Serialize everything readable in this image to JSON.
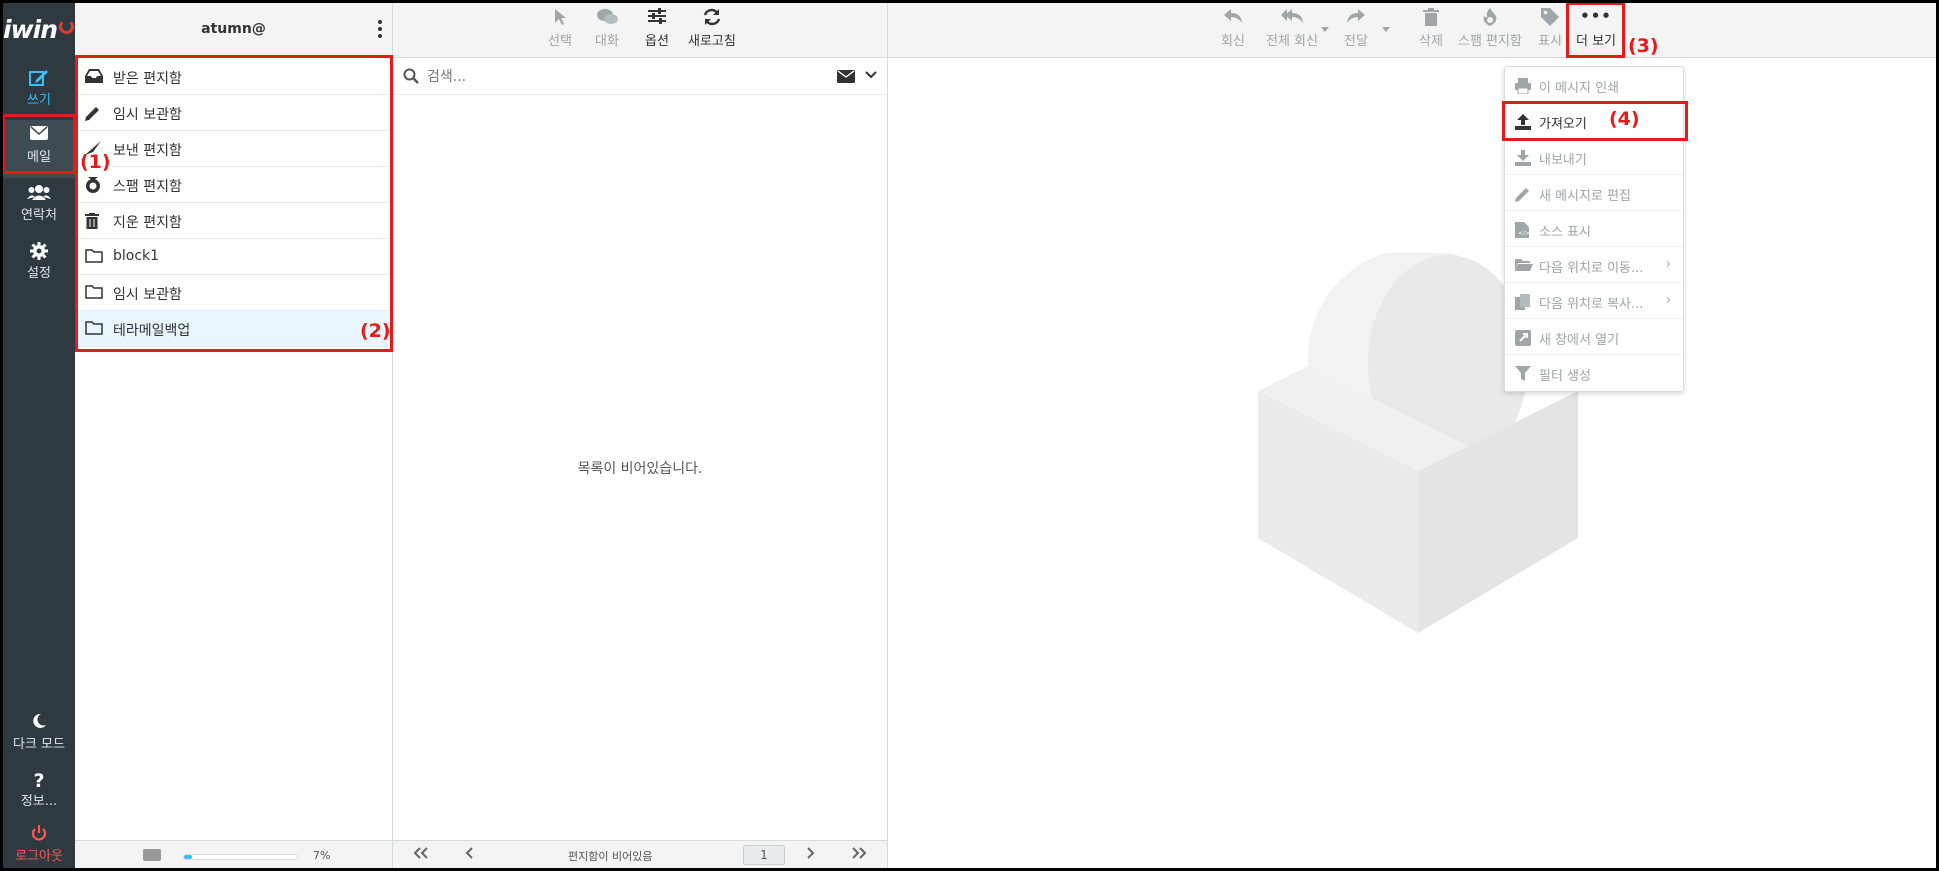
{
  "app": {
    "logo_text": "iwin",
    "user": "atumn@"
  },
  "nav": {
    "compose": "쓰기",
    "mail": "메일",
    "contacts": "연락처",
    "settings": "설정",
    "dark_mode": "다크 모드",
    "info": "정보...",
    "logout": "로그아웃"
  },
  "folders": [
    {
      "label": "받은 편지함",
      "icon": "inbox-icon"
    },
    {
      "label": "임시 보관함",
      "icon": "pencil-icon"
    },
    {
      "label": "보낸 편지함",
      "icon": "paper-plane-icon"
    },
    {
      "label": "스팸 편지함",
      "icon": "spam-icon"
    },
    {
      "label": "지운 편지함",
      "icon": "trash-icon"
    },
    {
      "label": "block1",
      "icon": "folder-icon"
    },
    {
      "label": "임시 보관함",
      "icon": "folder-icon"
    },
    {
      "label": "테라메일백업",
      "icon": "folder-icon",
      "selected": true
    }
  ],
  "quota": {
    "percent_label": "7%",
    "fraction": 0.07
  },
  "list_toolbar": {
    "select": "선택",
    "threads": "대화",
    "options": "옵션",
    "refresh": "새로고침"
  },
  "search": {
    "placeholder": "검색..."
  },
  "list": {
    "empty": "목록이 비어있습니다."
  },
  "pager": {
    "count": "편지함이 비어있음",
    "page": "1"
  },
  "preview_toolbar": {
    "reply": "회신",
    "reply_all": "전체 회신",
    "forward": "전달",
    "delete": "삭제",
    "spam": "스팸 편지함",
    "mark": "표시",
    "more": "더 보기"
  },
  "more_menu": [
    {
      "label": "이 메시지 인쇄",
      "enabled": false
    },
    {
      "label": "가져오기",
      "enabled": true
    },
    {
      "label": "내보내기",
      "enabled": false
    },
    {
      "label": "새 메시지로 편집",
      "enabled": false
    },
    {
      "label": "소스 표시",
      "enabled": false
    },
    {
      "label": "다음 위치로 이동...",
      "enabled": false,
      "submenu": true
    },
    {
      "label": "다음 위치로 복사...",
      "enabled": false,
      "submenu": true
    },
    {
      "label": "새 창에서 열기",
      "enabled": false
    },
    {
      "label": "필터 생성",
      "enabled": false
    }
  ],
  "annotations": {
    "a1": "(1)",
    "a2": "(2)",
    "a3": "(3)",
    "a4": "(4)"
  },
  "colors": {
    "nav_bg": "#2f3a40",
    "accent": "#37beff",
    "annotation": "#e31b1b",
    "logout": "#ff5552"
  }
}
